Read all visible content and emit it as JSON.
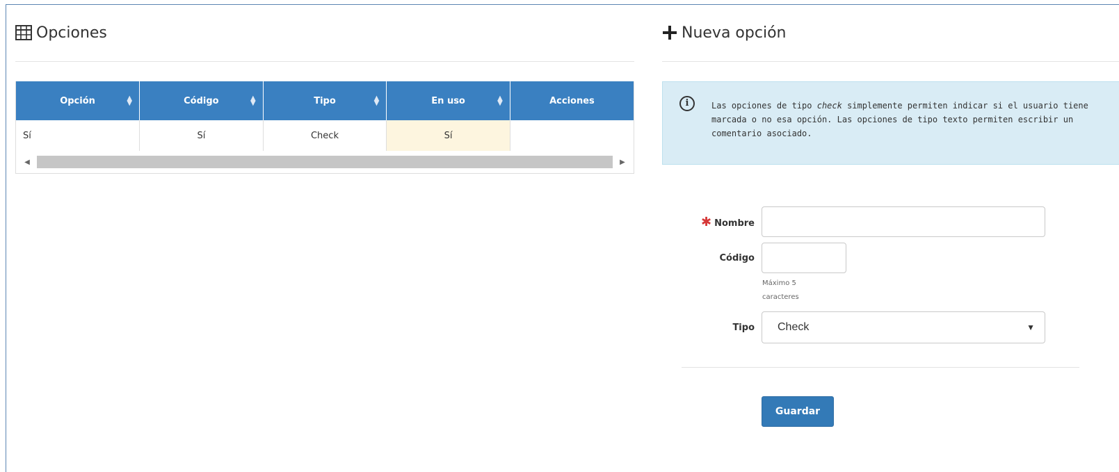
{
  "options_panel": {
    "title": "Opciones",
    "title_icon": "table-grid-icon",
    "table": {
      "columns": [
        "Opción",
        "Código",
        "Tipo",
        "En uso",
        "Acciones"
      ],
      "rows": [
        {
          "opcion": "Sí",
          "codigo": "Sí",
          "tipo": "Check",
          "en_uso": "Sí",
          "acciones": ""
        }
      ]
    }
  },
  "new_option_panel": {
    "title": "Nueva opción",
    "title_icon": "plus-icon",
    "info_icon": "info-circle-icon",
    "info": {
      "before": "Las opciones de tipo ",
      "emphasis": "check",
      "after": " simplemente permiten indicar si el usuario tiene marcada o no esa opción. Las opciones de tipo texto permiten escribir un comentario asociado."
    },
    "form": {
      "required_marker": "✱",
      "nombre_label": "Nombre",
      "nombre_value": "",
      "codigo_label": "Código",
      "codigo_value": "",
      "codigo_help_1": "Máximo 5",
      "codigo_help_2": "caracteres",
      "tipo_label": "Tipo",
      "tipo_value": "Check",
      "submit_label": "Guardar"
    }
  },
  "colors": {
    "header_blue": "#3a80c1",
    "button_blue": "#337ab7",
    "info_bg": "#d9ecf5",
    "highlight_cell": "#fdf5df",
    "required_red": "#d63737"
  }
}
